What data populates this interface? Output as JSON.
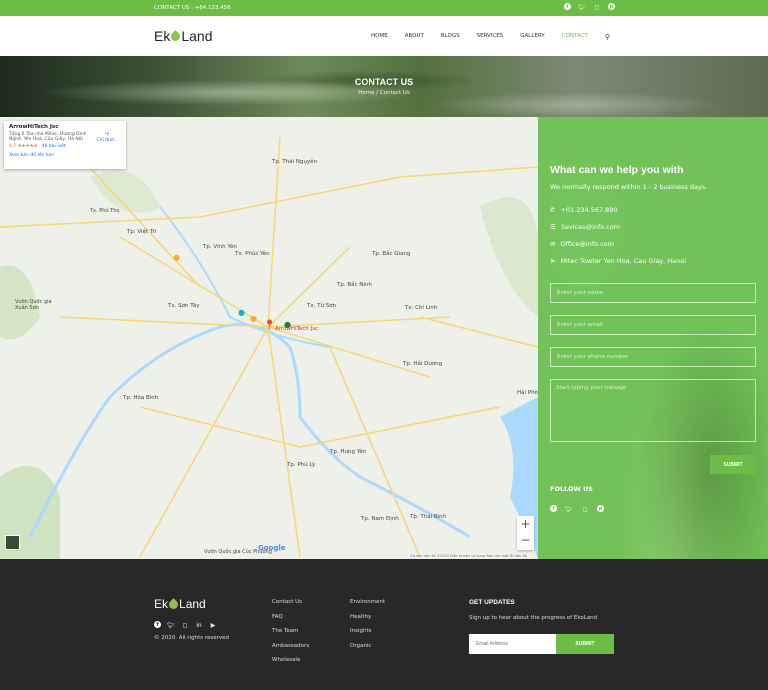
{
  "topbar": {
    "contact": "CONTACT US : +64.123.456",
    "social": [
      "facebook-icon",
      "twitter-icon",
      "instagram-icon",
      "pinterest-icon"
    ]
  },
  "header": {
    "logo": {
      "left": "Ek",
      "right": "Land"
    },
    "nav": [
      "HOME",
      "ABOUT",
      "BLOGS",
      "SERVICES",
      "GALLERY",
      "CONTACT"
    ],
    "active": "CONTACT"
  },
  "banner": {
    "title": "CONTACT US",
    "breadcrumb": "Home / Contact Us"
  },
  "map": {
    "card": {
      "title": "ArrowHiTech Jsc",
      "address": "Tầng 6 Tòa nhà Mitec, Dương Đình Nghệ, Yên Hoà, Cầu Giấy, Hà Nội",
      "rating": "4,7 ★★★★★",
      "reviews": "46 bài viết",
      "larger": "Xem bản đồ lớn hơn",
      "directions": "Chỉ đườ..."
    },
    "marker_label": "ArrowHiTech Jsc",
    "labels": [
      "Tp. Thái Nguyên",
      "Tx. Phú Thọ",
      "Tp. Việt Trì",
      "Tp. Vĩnh Yên",
      "Tx. Phúc Yên",
      "Tp. Bắc Giang",
      "Tp. Bắc Ninh",
      "Tx. Sơn Tây",
      "Tx. Từ Sơn",
      "Tx. Chí Linh",
      "Vườn Quốc gia Xuân Sơn",
      "Tp. Hải Dương",
      "Tp. Hòa Bình",
      "Tp. Hưng Yên",
      "Tp. Phủ Lý",
      "Tp. Nam Định",
      "Tp. Thái Bình",
      "Hải Phò",
      "Vườn Quốc gia Cúc Phương"
    ],
    "attribution": "Dữ liệu bản đồ ©2020   Điều khoản sử dụng   Báo cáo một lỗi bản đồ",
    "google": "Google"
  },
  "panel": {
    "title": "What can we help you with",
    "subtitle": "We normally respond within 1 - 2 business days.",
    "contacts": [
      {
        "icon": "phone-icon",
        "text": "+01.234.567.890"
      },
      {
        "icon": "list-icon",
        "text": "Sevices@info.com"
      },
      {
        "icon": "envelope-icon",
        "text": "Office@info.com"
      },
      {
        "icon": "location-arrow-icon",
        "text": "Mitec Towter Yen Hoa, Cau Giay, Hanoi"
      }
    ],
    "placeholders": {
      "name": "Enter your name",
      "email": "Enter your email",
      "phone": "Enter your phone number",
      "message": "Start typing your mesage"
    },
    "submit": "SUBMIT",
    "follow": "FOLLOW US"
  },
  "footer": {
    "logo": {
      "left": "Ek",
      "right": "Land"
    },
    "copyright": "© 2020. All rights reserved",
    "col1": [
      "Contact Us",
      "FAQ",
      "The Team",
      "Ambassadors",
      "Wholesale"
    ],
    "col2": [
      "Environment",
      "Healthy",
      "Insights",
      "Organic"
    ],
    "updates_title": "GET UPDATES",
    "updates_text": "Sign up to hear about the progress of EkoLand",
    "email_placeholder": "Email Address",
    "submit": "SUBMIT"
  },
  "colors": {
    "accent": "#6cbd45",
    "footer": "#282828",
    "panel": "#72c258"
  }
}
